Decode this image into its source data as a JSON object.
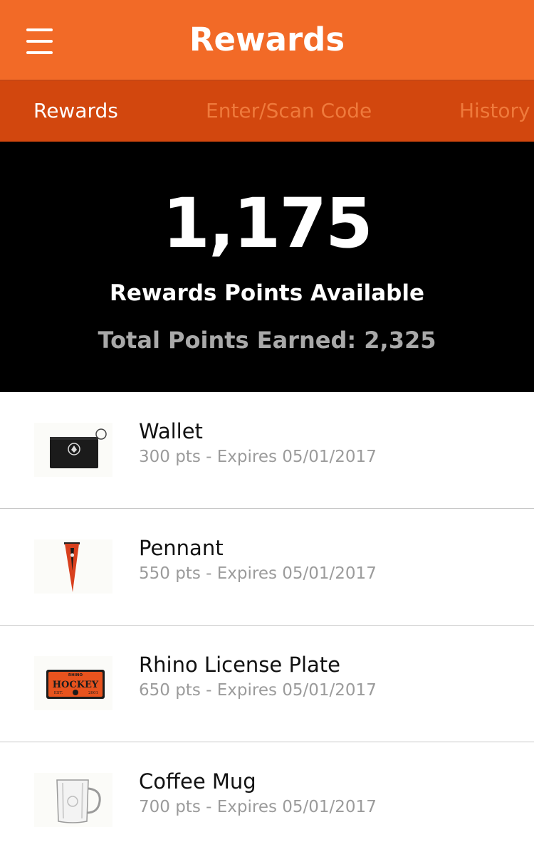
{
  "header": {
    "title": "Rewards",
    "menu_icon": "hamburger-menu-icon"
  },
  "tabs": [
    {
      "label": "Rewards",
      "active": true
    },
    {
      "label": "Enter/Scan Code",
      "active": false
    },
    {
      "label": "History",
      "active": false
    }
  ],
  "points": {
    "available": "1,175",
    "available_label": "Rewards Points Available",
    "total_earned": "Total Points Earned: 2,325"
  },
  "rewards": [
    {
      "name": "Wallet",
      "detail": "300 pts - Expires 05/01/2017",
      "icon": "wallet-icon"
    },
    {
      "name": "Pennant",
      "detail": "550 pts - Expires 05/01/2017",
      "icon": "pennant-icon"
    },
    {
      "name": "Rhino License Plate",
      "detail": "650 pts - Expires 05/01/2017",
      "icon": "license-plate-icon",
      "plate_text": {
        "top": "RHINO",
        "main": "HOCKEY",
        "left": "EST.",
        "right": "2001"
      }
    },
    {
      "name": "Coffee Mug",
      "detail": "700 pts - Expires 05/01/2017",
      "icon": "mug-icon"
    }
  ],
  "colors": {
    "app_bar": "#f26a27",
    "tab_bar": "#d2470e",
    "inactive_tab": "#ef7a3c",
    "points_panel": "#000000",
    "subtext": "#9b9b9b"
  }
}
